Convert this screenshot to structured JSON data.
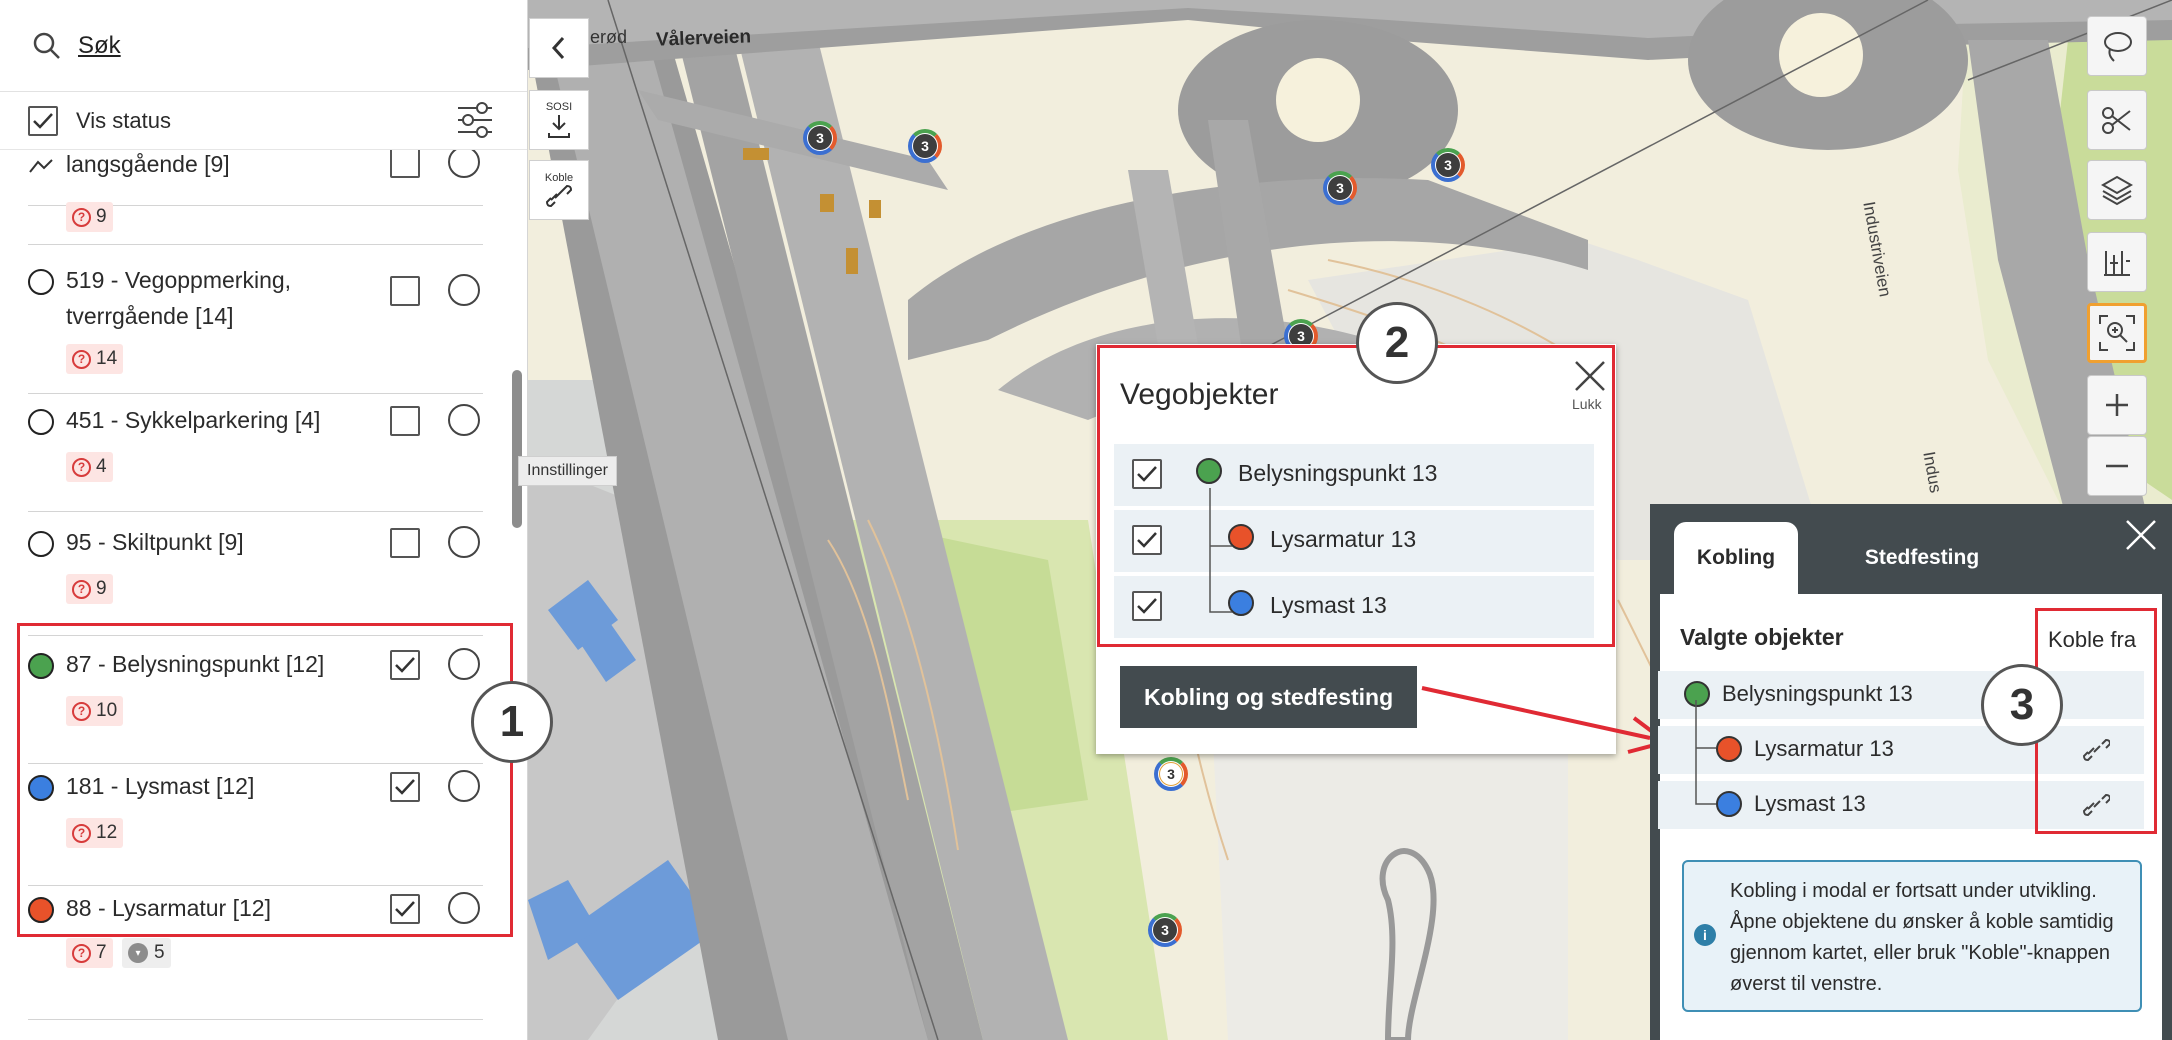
{
  "search": {
    "label": "Søk"
  },
  "vis_status": {
    "label": "Vis status"
  },
  "left_tools": {
    "sosi": "SOSI",
    "koble": "Koble"
  },
  "tooltip": "Innstillinger",
  "layers": [
    {
      "title": "... langsgående [9]",
      "dot_color": "",
      "checked": false,
      "issues": "9"
    },
    {
      "title": "519 - Vegoppmerking, tverrgående [14]",
      "dot_color": "#ffffff",
      "checked": false,
      "issues": "14"
    },
    {
      "title": "451 - Sykkelparkering [4]",
      "dot_color": "#ffffff",
      "checked": false,
      "issues": "4"
    },
    {
      "title": "95 - Skiltpunkt [9]",
      "dot_color": "#ffffff",
      "checked": false,
      "issues": "9"
    },
    {
      "title": "87 - Belysningspunkt [12]",
      "dot_color": "#4ba24f",
      "checked": true,
      "issues": "10"
    },
    {
      "title": "181 - Lysmast [12]",
      "dot_color": "#3b7fe0",
      "checked": true,
      "issues": "12"
    },
    {
      "title": "88 - Lysarmatur [12]",
      "dot_color": "#e8522a",
      "checked": true,
      "issues": "7",
      "extra": "5"
    }
  ],
  "map": {
    "road_labels": [
      "Vålerveien",
      "Industriveien",
      "Indus",
      "erød"
    ],
    "cluster_count": "3"
  },
  "vegobjekter": {
    "title": "Vegobjekter",
    "close_label": "Lukk",
    "items": [
      {
        "label": "Belysningspunkt 13",
        "color": "#4ba24f"
      },
      {
        "label": "Lysarmatur 13",
        "color": "#e8522a"
      },
      {
        "label": "Lysmast 13",
        "color": "#3b7fe0"
      }
    ],
    "button": "Kobling og stedfesting"
  },
  "kobling": {
    "tabs": [
      "Kobling",
      "Stedfesting"
    ],
    "section_title": "Valgte objekter",
    "koble_fra": "Koble fra",
    "items": [
      {
        "label": "Belysningspunkt 13",
        "color": "#4ba24f"
      },
      {
        "label": "Lysarmatur 13",
        "color": "#e8522a"
      },
      {
        "label": "Lysmast 13",
        "color": "#3b7fe0"
      }
    ],
    "info": "Kobling i modal er fortsatt under utvikling. Åpne objektene du ønsker å koble samtidig gjennom kartet, eller bruk \"Koble\"-knappen øverst til venstre."
  },
  "callouts": [
    "1",
    "2",
    "3"
  ]
}
